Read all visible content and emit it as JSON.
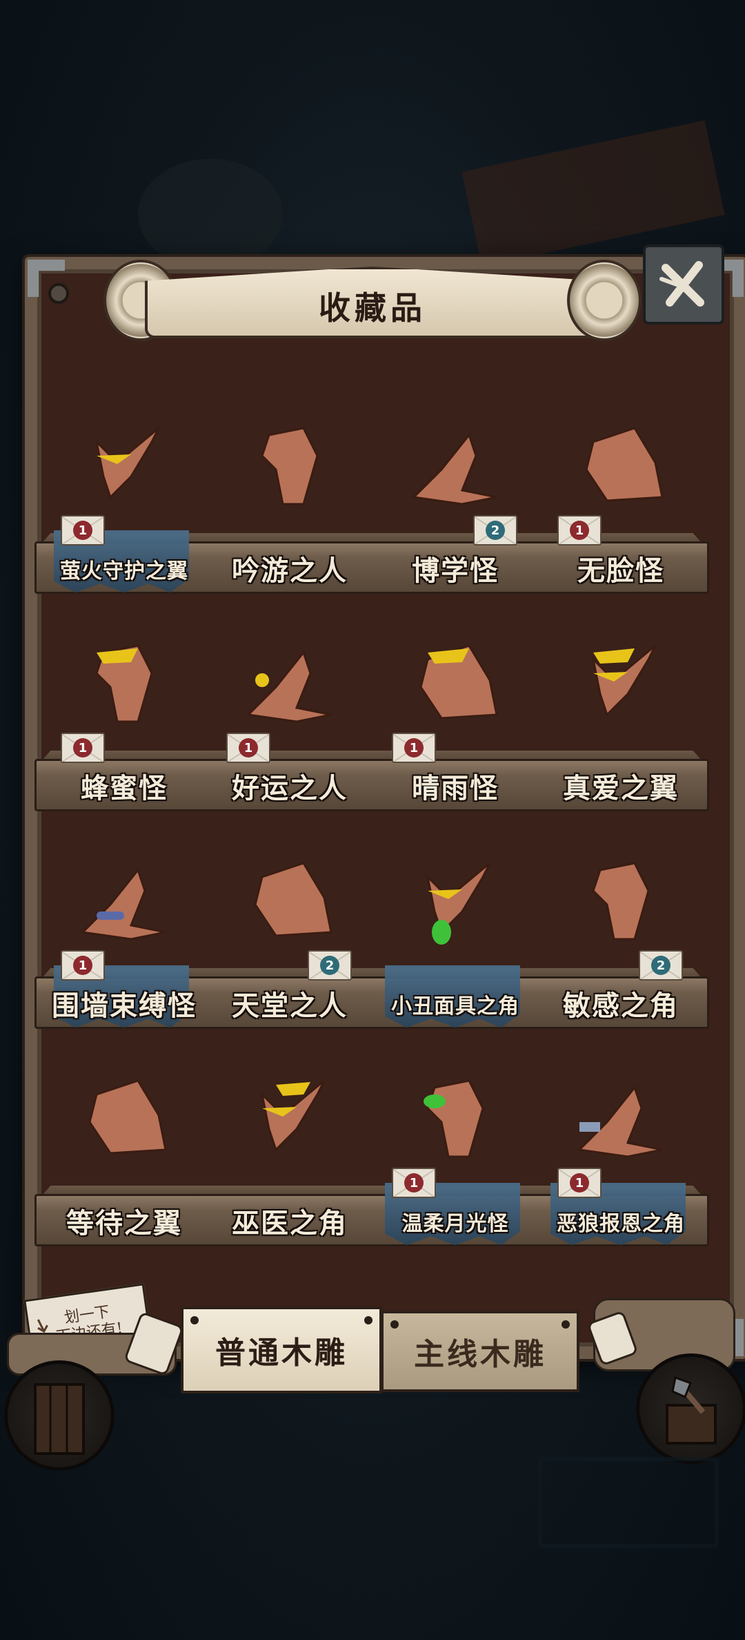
{
  "header": {
    "title": "收藏品"
  },
  "shelves": [
    {
      "items": [
        {
          "name": "萤火守护之翼",
          "badge": "1",
          "badge_color": "red",
          "badge_side": "left",
          "has_platform": true,
          "small": true
        },
        {
          "name": "吟游之人",
          "badge": "",
          "badge_color": "",
          "has_platform": false,
          "small": false
        },
        {
          "name": "博学怪",
          "badge": "2",
          "badge_color": "teal",
          "badge_side": "right",
          "has_platform": false,
          "small": false
        },
        {
          "name": "无脸怪",
          "badge": "1",
          "badge_color": "red",
          "badge_side": "left",
          "has_platform": false,
          "small": false
        }
      ]
    },
    {
      "items": [
        {
          "name": "蜂蜜怪",
          "badge": "1",
          "badge_color": "red",
          "badge_side": "left",
          "has_platform": false,
          "small": false
        },
        {
          "name": "好运之人",
          "badge": "1",
          "badge_color": "red",
          "badge_side": "left",
          "has_platform": false,
          "small": false
        },
        {
          "name": "晴雨怪",
          "badge": "1",
          "badge_color": "red",
          "badge_side": "left",
          "has_platform": false,
          "small": false
        },
        {
          "name": "真爱之翼",
          "badge": "",
          "badge_color": "",
          "has_platform": false,
          "small": false
        }
      ]
    },
    {
      "items": [
        {
          "name": "围墙束缚怪",
          "badge": "1",
          "badge_color": "red",
          "badge_side": "left",
          "has_platform": true,
          "small": false
        },
        {
          "name": "天堂之人",
          "badge": "2",
          "badge_color": "teal",
          "badge_side": "right",
          "has_platform": false,
          "small": false
        },
        {
          "name": "小丑面具之角",
          "badge": "",
          "badge_color": "",
          "has_platform": true,
          "small": true
        },
        {
          "name": "敏感之角",
          "badge": "2",
          "badge_color": "teal",
          "badge_side": "right",
          "has_platform": false,
          "small": false
        }
      ]
    },
    {
      "items": [
        {
          "name": "等待之翼",
          "badge": "",
          "badge_color": "",
          "has_platform": false,
          "small": false
        },
        {
          "name": "巫医之角",
          "badge": "",
          "badge_color": "",
          "has_platform": false,
          "small": false
        },
        {
          "name": "温柔月光怪",
          "badge": "1",
          "badge_color": "red",
          "badge_side": "left",
          "has_platform": true,
          "small": true
        },
        {
          "name": "恶狼报恩之角",
          "badge": "1",
          "badge_color": "red",
          "badge_side": "left",
          "has_platform": true,
          "small": true
        }
      ]
    }
  ],
  "hint": {
    "line1": "划一下",
    "line2": "下边还有!"
  },
  "tabs": [
    {
      "label": "普通木雕",
      "active": true
    },
    {
      "label": "主线木雕",
      "active": false
    }
  ],
  "colors": {
    "wood_figure": "#b87258",
    "accent_yellow": "#e8c41a",
    "accent_green": "#3fc23a"
  }
}
